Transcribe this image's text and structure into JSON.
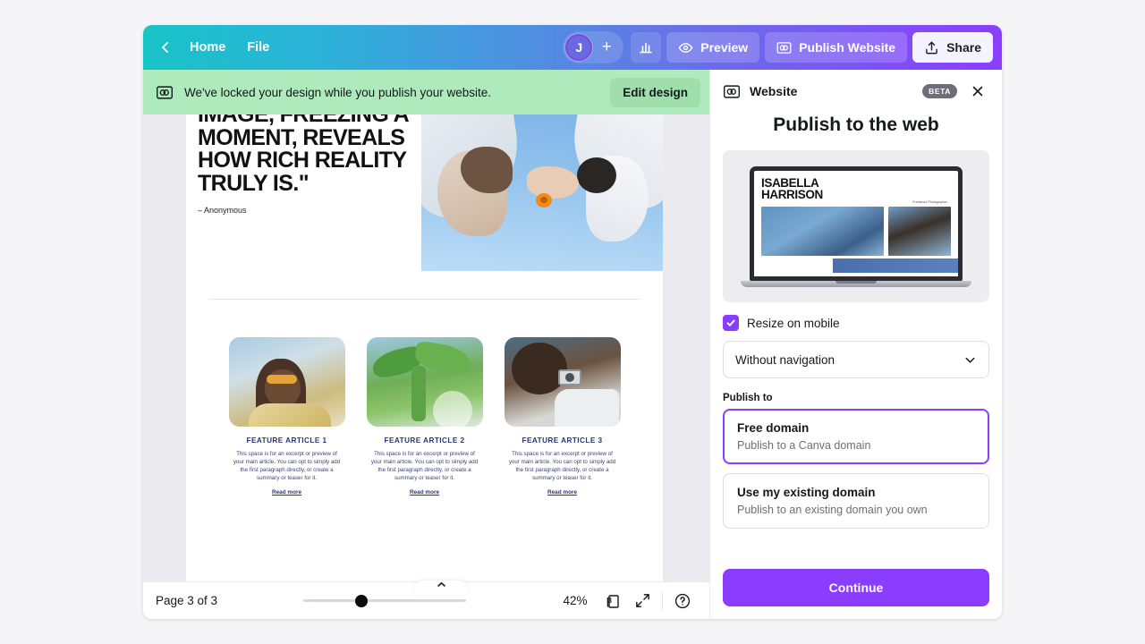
{
  "topbar": {
    "back_icon": "chevron-left-icon",
    "home_label": "Home",
    "file_label": "File",
    "avatar_initial": "J",
    "add_member_label": "+",
    "insights_icon": "bar-chart-icon",
    "preview_label": "Preview",
    "preview_icon": "eye-icon",
    "publish_label": "Publish Website",
    "publish_icon": "website-icon",
    "share_label": "Share",
    "share_icon": "upload-icon"
  },
  "banner": {
    "icon": "website-icon",
    "message": "We've locked your design while you publish your website.",
    "action_label": "Edit design"
  },
  "canvas": {
    "quote": "IMAGE, FREEZING A MOMENT, REVEALS HOW RICH REALITY TRULY IS.\"",
    "quote_attribution": "– Anonymous",
    "cards": [
      {
        "title": "FEATURE ARTICLE 1",
        "body": "This space is for an excerpt or preview of your main article. You can opt to simply add the first paragraph directly, or create a summary or teaser for it.",
        "link": "Read more"
      },
      {
        "title": "FEATURE ARTICLE 2",
        "body": "This space is for an excerpt or preview of your main article. You can opt to simply add the first paragraph directly, or create a summary or teaser for it.",
        "link": "Read more"
      },
      {
        "title": "FEATURE ARTICLE 3",
        "body": "This space is for an excerpt or preview of your main article. You can opt to simply add the first paragraph directly, or create a summary or teaser for it.",
        "link": "Read more"
      }
    ]
  },
  "statusbar": {
    "page_label": "Page 3 of 3",
    "zoom_value": "42%",
    "page_count": "3",
    "pages_icon": "pages-icon",
    "fullscreen_icon": "expand-icon",
    "help_icon": "help-icon"
  },
  "panel": {
    "icon": "website-icon",
    "title": "Website",
    "badge": "BETA",
    "close_icon": "close-icon",
    "heading": "Publish to the web",
    "preview": {
      "site_title_line1": "ISABELLA",
      "site_title_line2": "HARRISON",
      "site_subtitle": "Freelance Photographer"
    },
    "resize_label": "Resize on mobile",
    "resize_checked": true,
    "navigation_value": "Without navigation",
    "navigation_icon": "chevron-down-icon",
    "publish_to_label": "Publish to",
    "options": [
      {
        "title": "Free domain",
        "description": "Publish to a Canva domain",
        "selected": true
      },
      {
        "title": "Use my existing domain",
        "description": "Publish to an existing domain you own",
        "selected": false
      }
    ],
    "continue_label": "Continue"
  },
  "colors": {
    "accent": "#8b3dff",
    "banner_bg": "#aeeabc",
    "gradient_start": "#18c3c6",
    "gradient_end": "#8b3dff"
  }
}
